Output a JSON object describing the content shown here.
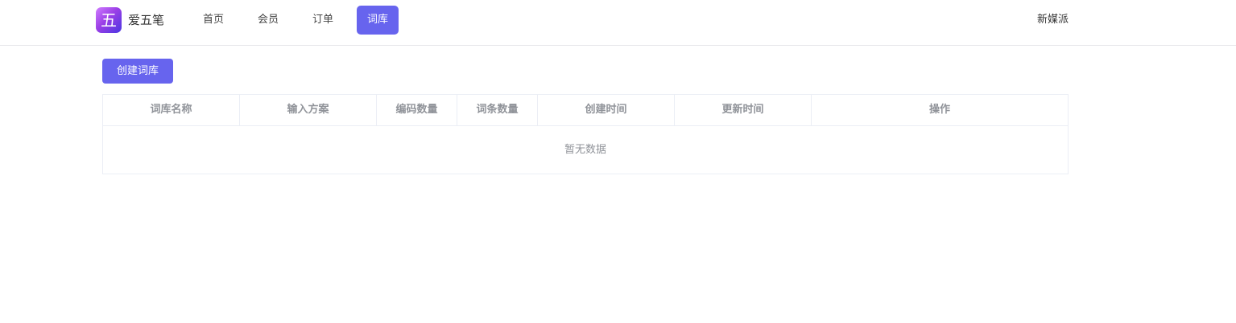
{
  "app": {
    "logo_char": "五",
    "name": "爱五笔"
  },
  "nav": {
    "items": [
      {
        "label": "首页"
      },
      {
        "label": "会员"
      },
      {
        "label": "订单"
      },
      {
        "label": "词库",
        "active": true
      }
    ]
  },
  "user": {
    "name": "新媒派"
  },
  "toolbar": {
    "create_label": "创建词库"
  },
  "table": {
    "columns": [
      "词库名称",
      "输入方案",
      "编码数量",
      "词条数量",
      "创建时间",
      "更新时间",
      "操作"
    ],
    "rows": [],
    "empty_text": "暂无数据"
  },
  "colors": {
    "accent": "#6764ee",
    "header_text": "#909399",
    "border": "#ebeef5"
  }
}
